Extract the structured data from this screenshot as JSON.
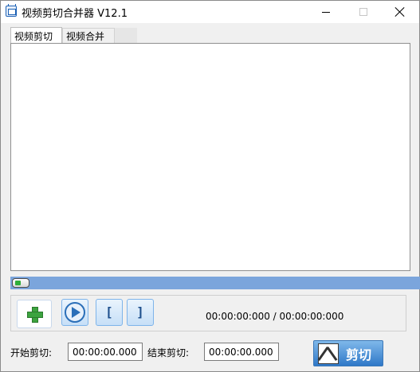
{
  "window": {
    "title": "视频剪切合并器 V12.1"
  },
  "tabs": [
    {
      "label": "视频剪切",
      "active": true
    },
    {
      "label": "视频合并",
      "active": false
    }
  ],
  "player": {
    "progress_fraction": 0.0,
    "time_display": "00:00:00:000 / 00:00:00:000"
  },
  "cut": {
    "start_label": "开始剪切:",
    "start_value": "00:00:00.000",
    "end_label": "结束剪切:",
    "end_value": "00:00:00.000",
    "button_label": "剪切"
  },
  "colors": {
    "progress_track": "#7ba5dc",
    "accent_green": "#3ca33f",
    "button_blue": "#2f78c8"
  },
  "icons": {
    "app": "video-app-icon",
    "add": "plus-icon",
    "play": "play-icon",
    "mark_in": "bracket-left-icon",
    "mark_out": "bracket-right-icon",
    "cut": "scissors-film-icon"
  }
}
